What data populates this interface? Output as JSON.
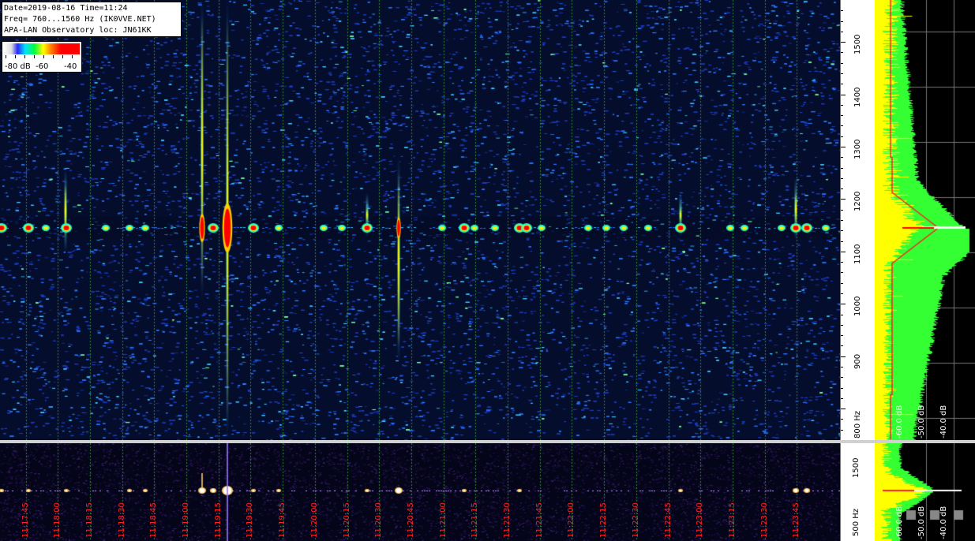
{
  "header": {
    "date_line": "Date=2019-08-16 Time=11:24",
    "freq_line": "Freq= 760...1560 Hz (IK0VVE.NET)",
    "loc_line": "APA-LAN Observatory loc: JN61KK"
  },
  "legend": {
    "labels": [
      "-80 dB",
      "-60",
      "-40"
    ]
  },
  "freq_axis": {
    "labels": [
      "1500",
      "1400",
      "1300",
      "1200",
      "1100",
      "1000",
      "900",
      "800 Hz"
    ],
    "values": [
      1500,
      1400,
      1300,
      1200,
      1100,
      1000,
      900,
      800
    ]
  },
  "overview_axis": {
    "labels": [
      "1500",
      "500 Hz"
    ]
  },
  "db_labels": [
    "-60.0 dB",
    "-50.0 dB",
    "-40.0 dB"
  ],
  "overview_db_labels": [
    "-60.0 dB",
    "-50.0 dB",
    "-40.0 dB"
  ],
  "time_labels": [
    "11:17:45",
    "11:18:00",
    "11:18:15",
    "11:18:30",
    "11:18:45",
    "11:19:00",
    "11:19:15",
    "11:19:30",
    "11:19:45",
    "11:20:00",
    "11:20:15",
    "11:20:30",
    "11:20:45",
    "11:21:00",
    "11:21:15",
    "11:21:30",
    "11:21:45",
    "11:22:00",
    "11:22:15",
    "11:22:30",
    "11:22:45",
    "11:23:00",
    "11:23:15",
    "11:23:30",
    "11:23:45"
  ],
  "colors": {
    "background": "#050d2c",
    "grid": "#2f8a2f",
    "carrier": "#ff0000",
    "spectrum_avg": "#ffff00",
    "spectrum_peak": "#33ff33",
    "spectrum_min": "#ff2020",
    "time_label": "#ff2020"
  }
}
